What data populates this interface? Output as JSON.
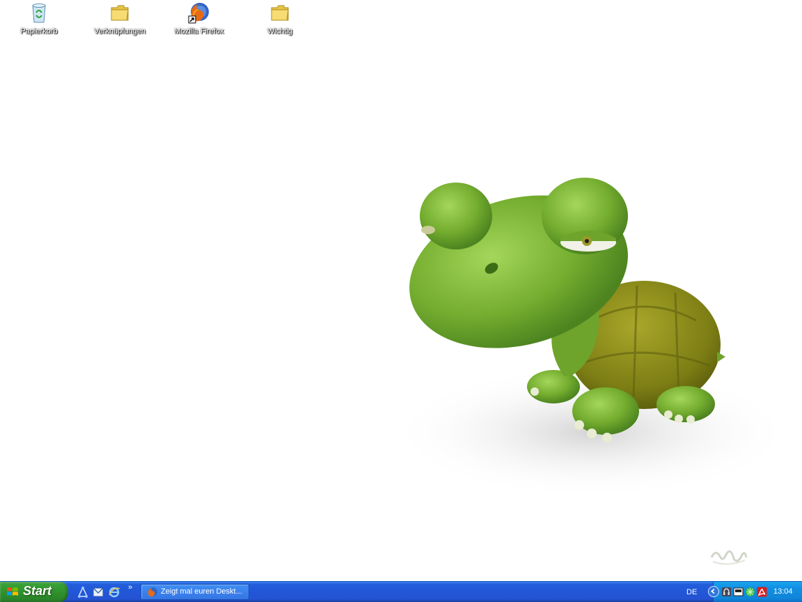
{
  "desktop": {
    "icons": [
      {
        "label": "Papierkorb",
        "icon": "recycle-bin-icon"
      },
      {
        "label": "Verknüpfungen",
        "icon": "folder-icon"
      },
      {
        "label": "Mozilla Firefox",
        "icon": "firefox-icon"
      },
      {
        "label": "Wichtig",
        "icon": "folder-icon"
      }
    ],
    "wallpaper": "turtle-wallpaper"
  },
  "taskbar": {
    "start_label": "Start",
    "quick_launch": [
      "network-icon",
      "outlook-icon",
      "internet-explorer-icon"
    ],
    "chevron": "»",
    "tasks": [
      {
        "label": "Zeigt mal euren Deskt...",
        "icon": "firefox-icon"
      }
    ],
    "language": "DE",
    "tray_icons": [
      "headset-icon",
      "device-icon",
      "antivirus-icon",
      "acrobat-icon"
    ],
    "clock": "13:04"
  },
  "colors": {
    "taskbar_blue": "#245edb",
    "start_green": "#37a135",
    "tray_blue": "#1190e3"
  }
}
